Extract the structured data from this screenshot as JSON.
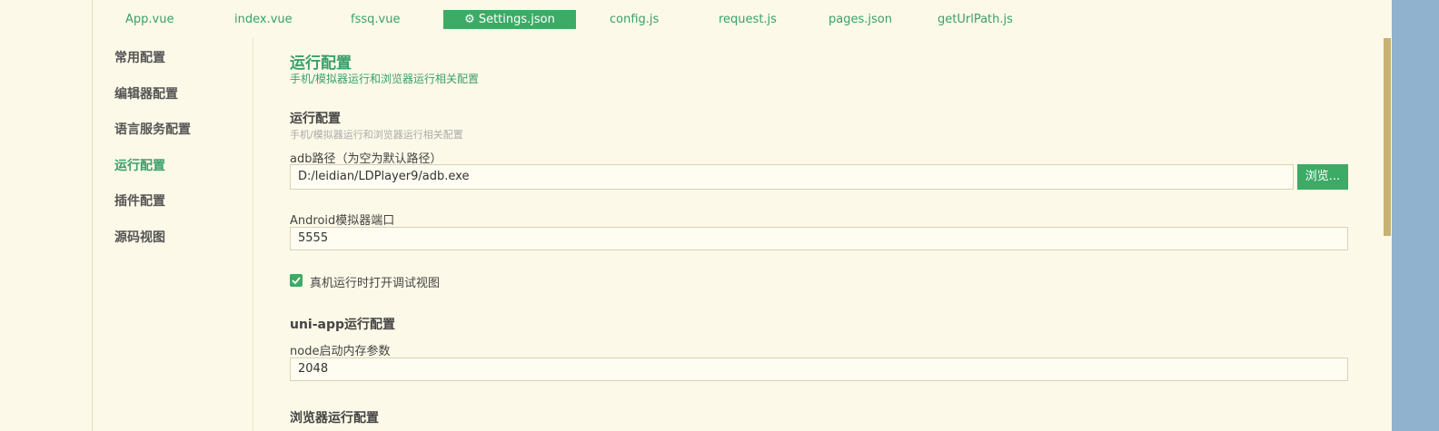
{
  "tabs": [
    {
      "label": "App.vue",
      "active": false
    },
    {
      "label": "index.vue",
      "active": false
    },
    {
      "label": "fssq.vue",
      "active": false
    },
    {
      "label": "Settings.json",
      "active": true
    },
    {
      "label": "config.js",
      "active": false
    },
    {
      "label": "request.js",
      "active": false
    },
    {
      "label": "pages.json",
      "active": false
    },
    {
      "label": "getUrlPath.js",
      "active": false
    }
  ],
  "sidebar": {
    "items": [
      {
        "label": "常用配置",
        "active": false
      },
      {
        "label": "编辑器配置",
        "active": false
      },
      {
        "label": "语言服务配置",
        "active": false
      },
      {
        "label": "运行配置",
        "active": true
      },
      {
        "label": "插件配置",
        "active": false
      },
      {
        "label": "源码视图",
        "active": false
      }
    ]
  },
  "main": {
    "title": "运行配置",
    "subtitle": "手机/模拟器运行和浏览器运行相关配置",
    "run_section": {
      "title": "运行配置",
      "subtitle": "手机/模拟器运行和浏览器运行相关配置",
      "adb_label": "adb路径（为空为默认路径）",
      "adb_value": "D:/leidian/LDPlayer9/adb.exe",
      "browse_label": "浏览...",
      "port_label": "Android模拟器端口",
      "port_value": "5555",
      "debug_checkbox_label": "真机运行时打开调试视图",
      "debug_checked": true
    },
    "uniapp_section": {
      "title": "uni-app运行配置",
      "node_label": "node启动内存参数",
      "node_value": "2048"
    },
    "browser_section": {
      "title": "浏览器运行配置"
    }
  },
  "colors": {
    "accent": "#3daa66",
    "background": "#fdf9e8",
    "scroll_thumb": "#c8b273",
    "right_panel": "#90b2cf"
  }
}
